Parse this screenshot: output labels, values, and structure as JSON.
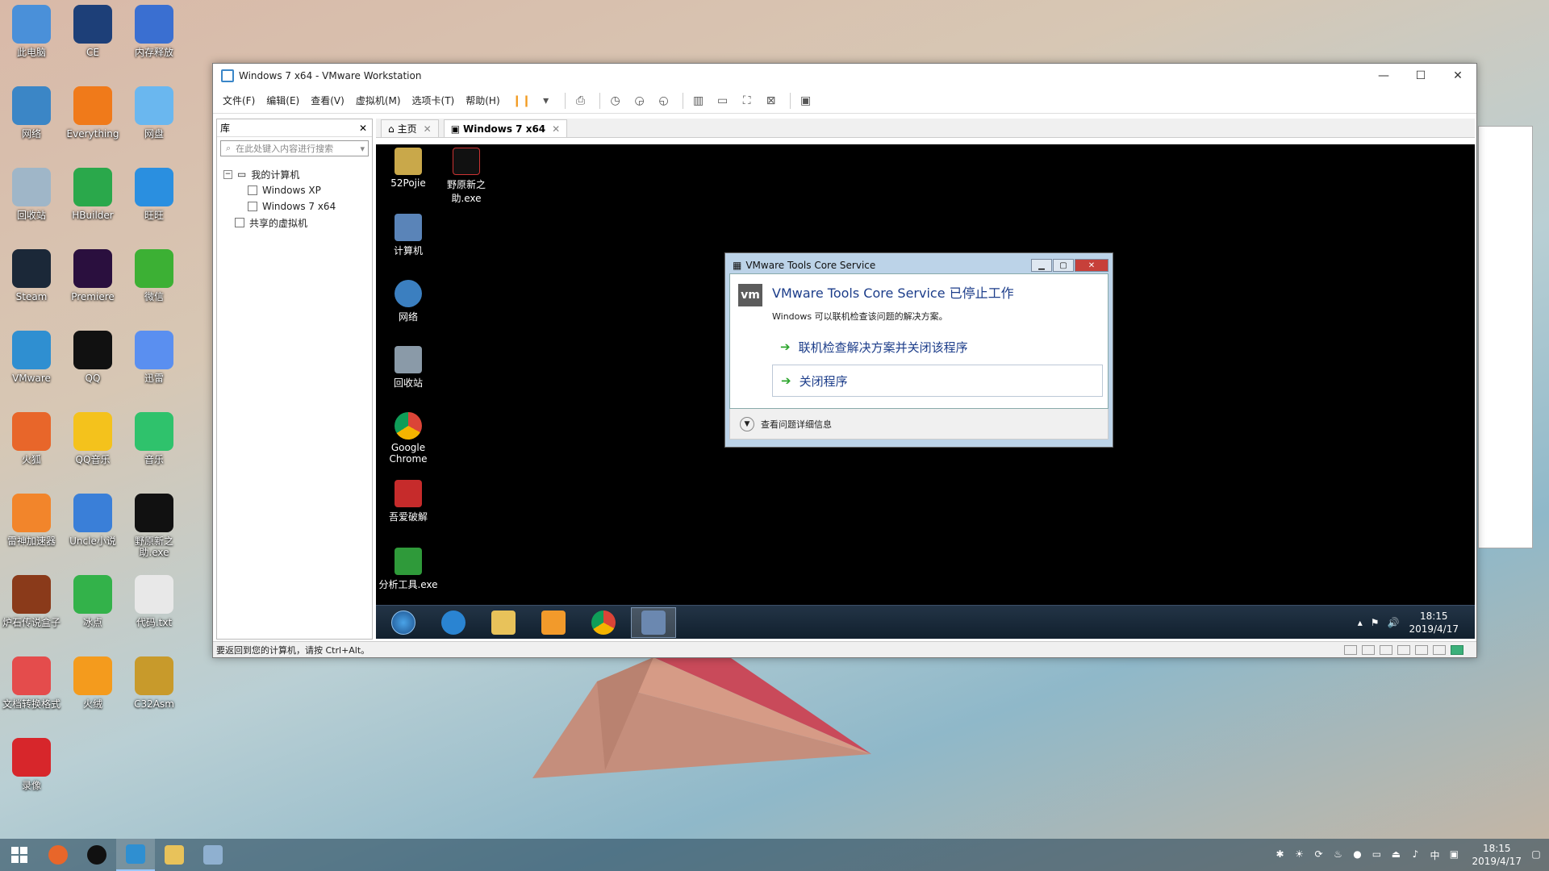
{
  "desktop": {
    "icons": [
      {
        "label": "此电脑",
        "color": "#4a90d9"
      },
      {
        "label": "CE",
        "color": "#1d3f78"
      },
      {
        "label": "内存释放",
        "color": "#3a6fd1"
      },
      {
        "label": "网络",
        "color": "#3b86c6"
      },
      {
        "label": "Everything",
        "color": "#f07a1a"
      },
      {
        "label": "网盘",
        "color": "#6ab7ef"
      },
      {
        "label": "回收站",
        "color": "#9fb6c8"
      },
      {
        "label": "HBuilder",
        "color": "#2aa84b"
      },
      {
        "label": "旺旺",
        "color": "#2a8fe0"
      },
      {
        "label": "Steam",
        "color": "#1b2838"
      },
      {
        "label": "Premiere",
        "color": "#2a0f3e"
      },
      {
        "label": "微信",
        "color": "#3cb034"
      },
      {
        "label": "VMware",
        "color": "#2f8fd1"
      },
      {
        "label": "QQ",
        "color": "#111111"
      },
      {
        "label": "迅雷",
        "color": "#5a8ff0"
      },
      {
        "label": "火狐",
        "color": "#e8662a"
      },
      {
        "label": "QQ音乐",
        "color": "#f4c21c"
      },
      {
        "label": "音乐",
        "color": "#2fc26c"
      },
      {
        "label": "雷神加速器",
        "color": "#f2852b"
      },
      {
        "label": "Uncle小说",
        "color": "#3a7fd8"
      },
      {
        "label": "野原新之助.exe",
        "color": "#111111"
      },
      {
        "label": "炉石传说盒子",
        "color": "#8a3a1a"
      },
      {
        "label": "冰点",
        "color": "#33b24a"
      },
      {
        "label": "代码.txt",
        "color": "#e8e8e8"
      },
      {
        "label": "文档转换格式",
        "color": "#e44c4c"
      },
      {
        "label": "火绒",
        "color": "#f49b1d"
      },
      {
        "label": "C32Asm",
        "color": "#c89a2b"
      },
      {
        "label": "录像",
        "color": "#d7262b"
      }
    ]
  },
  "vmware": {
    "title": "Windows 7 x64 - VMware Workstation",
    "controls": {
      "min": "—",
      "max": "☐",
      "close": "✕"
    },
    "menu": [
      "文件(F)",
      "编辑(E)",
      "查看(V)",
      "虚拟机(M)",
      "选项卡(T)",
      "帮助(H)"
    ],
    "library": {
      "title": "库",
      "close": "✕",
      "search_placeholder": "在此处键入内容进行搜索",
      "tree": [
        {
          "label": "我的计算机",
          "level": 0
        },
        {
          "label": "Windows XP",
          "level": 1
        },
        {
          "label": "Windows 7 x64",
          "level": 1
        },
        {
          "label": "共享的虚拟机",
          "level": 0
        }
      ]
    },
    "tabs": [
      {
        "label": "主页",
        "active": false
      },
      {
        "label": "Windows 7 x64",
        "active": true
      }
    ],
    "status_text": "要返回到您的计算机，请按 Ctrl+Alt。"
  },
  "guest": {
    "icons": [
      {
        "label": "52Pojie"
      },
      {
        "label": "野原新之助.exe"
      },
      {
        "label": "计算机"
      },
      {
        "label": "网络"
      },
      {
        "label": "回收站"
      },
      {
        "label": "Google Chrome"
      },
      {
        "label": "吾爱破解"
      },
      {
        "label": "分析工具.exe"
      }
    ],
    "clock_time": "18:15",
    "clock_date": "2019/4/17"
  },
  "dialog": {
    "title": "VMware Tools Core Service",
    "logo": "vm",
    "heading": "VMware Tools Core Service 已停止工作",
    "subtitle": "Windows 可以联机检查该问题的解决方案。",
    "option1": "联机检查解决方案并关闭该程序",
    "option2": "关闭程序",
    "details": "查看问题详细信息"
  },
  "taskbar": {
    "clock_time": "18:15",
    "clock_date": "2019/4/17",
    "ime": "中"
  }
}
